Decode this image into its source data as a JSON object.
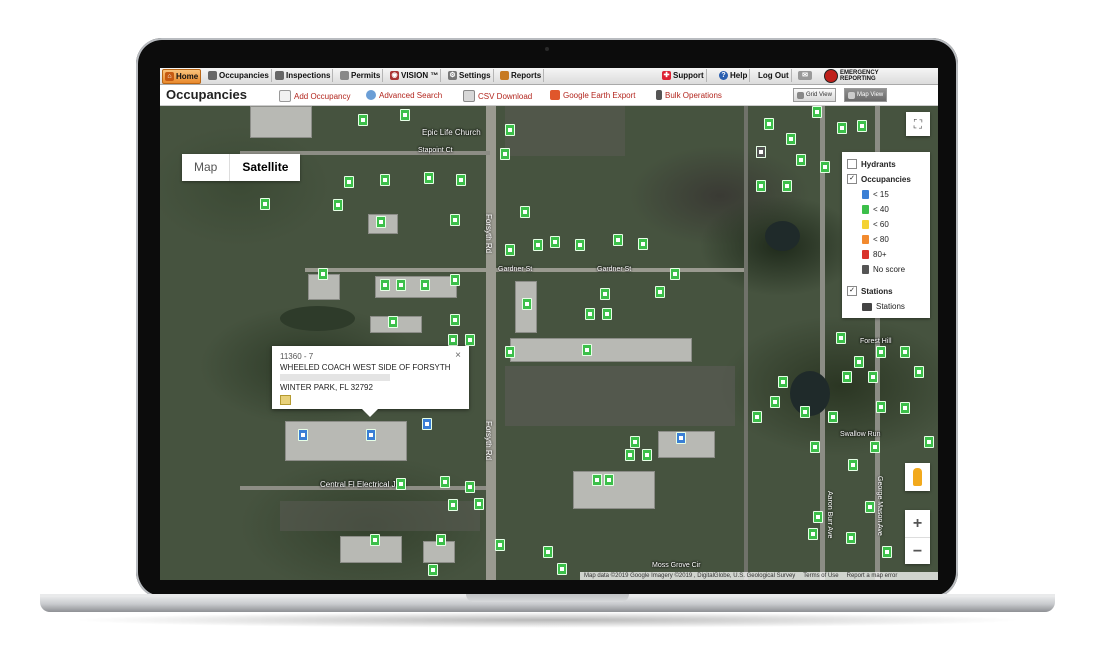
{
  "nav": {
    "tabs": [
      {
        "label": "Home",
        "icon": "home-icon"
      },
      {
        "label": "Occupancies",
        "icon": "building-icon"
      },
      {
        "label": "Inspections",
        "icon": "clipboard-icon"
      },
      {
        "label": "Permits",
        "icon": "document-icon"
      },
      {
        "label": "VISION ™",
        "icon": "eye-icon"
      },
      {
        "label": "Settings",
        "icon": "gear-icon"
      },
      {
        "label": "Reports",
        "icon": "chart-icon"
      }
    ],
    "right": {
      "support": "Support",
      "help": "Help",
      "logout": "Log Out",
      "logo_line1": "EMERGENCY",
      "logo_line2": "REPORTING"
    }
  },
  "subbar": {
    "title": "Occupancies",
    "actions": {
      "add": "Add Occupancy",
      "search": "Advanced Search",
      "csv": "CSV Download",
      "earth": "Google Earth Export",
      "bulk": "Bulk Operations"
    },
    "views": {
      "grid": "Grid View",
      "map": "Map View"
    }
  },
  "map": {
    "type_control": {
      "map": "Map",
      "satellite": "Satellite"
    },
    "labels": {
      "church": "Epic Life Church",
      "stapoint": "Stapoint Ct",
      "forsyth1": "Forsyth Rd",
      "forsyth2": "Forsyth Rd",
      "gardner1": "Gardner St",
      "gardner2": "Gardner St",
      "forest": "Forest Hill",
      "swallow": "Swallow Run",
      "central": "Central Fl Electrical Jatc",
      "moss": "Moss Grove Cir",
      "aaron": "Aaron Burr Ave",
      "george": "George Mason Ave"
    },
    "legend": {
      "hydrants": "Hydrants",
      "occupancies": "Occupancies",
      "scores": [
        {
          "label": "< 15",
          "color": "#3a7fd5"
        },
        {
          "label": "< 40",
          "color": "#3cbf4a"
        },
        {
          "label": "< 60",
          "color": "#f4d234"
        },
        {
          "label": "< 80",
          "color": "#f28a2e"
        },
        {
          "label": "80+",
          "color": "#d9322b"
        },
        {
          "label": "No score",
          "color": "#555555"
        }
      ],
      "stations": "Stations",
      "stations_item": "Stations"
    },
    "popup": {
      "id": "11360 - 7",
      "name": "WHEELED COACH WEST SIDE OF FORSYTH",
      "city": "WINTER PARK, FL 32792"
    },
    "attribution": {
      "data": "Map data ©2019 Google Imagery ©2019 , DigitalGlobe, U.S. Geological Survey",
      "terms": "Terms of Use",
      "report": "Report a map error"
    }
  }
}
